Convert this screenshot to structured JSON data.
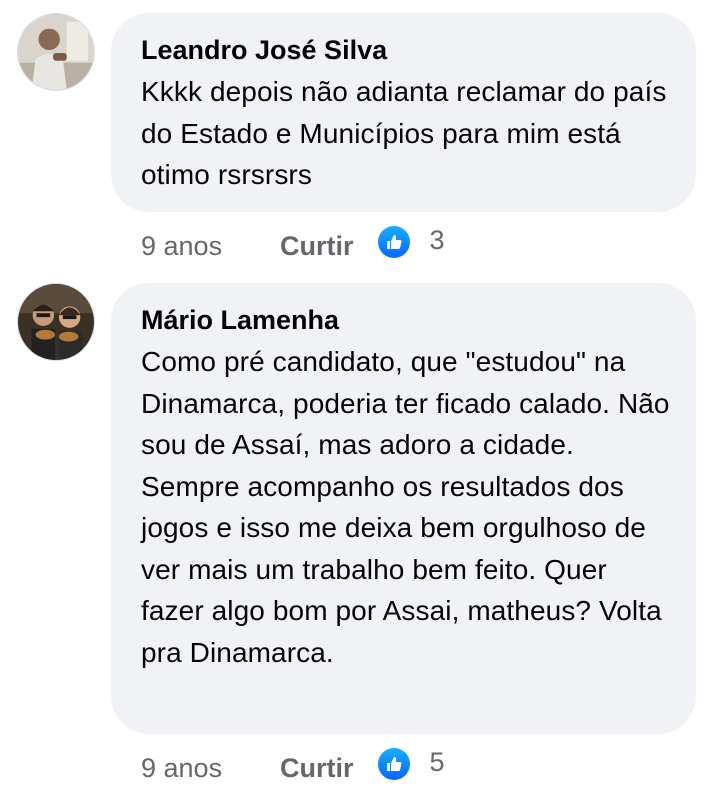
{
  "comments": [
    {
      "author": "Leandro José Silva",
      "avatar_icon": "user-photo-man-eating",
      "text": "Kkkk depois não adianta reclamar do país do Estado e Municípios para mim está otimo rsrsrsrs",
      "time": "9 anos",
      "like_label": "Curtir",
      "reaction_icon": "thumbs-up-icon",
      "reaction_count": "3"
    },
    {
      "author": "Mário Lamenha",
      "avatar_icon": "user-photo-two-people",
      "text": "Como pré candidato, que \"estudou\" na Dinamarca, poderia ter ficado calado. Não sou de Assaí, mas adoro a cidade. Sempre acompanho os resultados dos jogos e isso me deixa bem orgulhoso de ver mais um trabalho bem feito. Quer fazer algo bom por Assai, matheus? Volta pra Dinamarca.",
      "time": "9 anos",
      "like_label": "Curtir",
      "reaction_icon": "thumbs-up-icon",
      "reaction_count": "5"
    }
  ],
  "colors": {
    "bubble": "#f0f2f5",
    "text": "#050505",
    "secondary": "#65676b",
    "like_blue": "#0866ff"
  }
}
